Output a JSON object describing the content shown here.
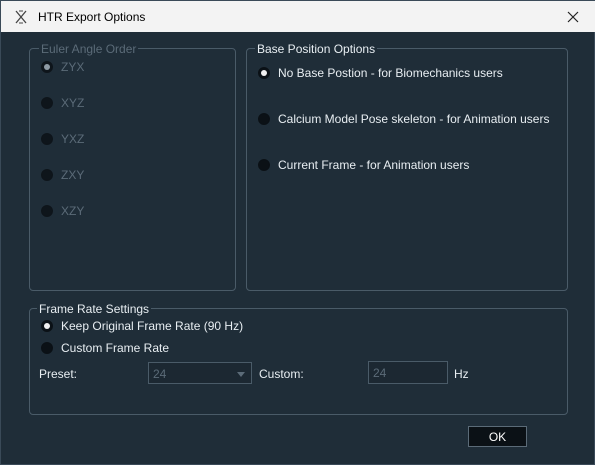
{
  "window": {
    "title": "HTR Export Options",
    "app_icon": "htr-app-icon",
    "close_icon": "close-icon"
  },
  "euler": {
    "legend": "Euler Angle Order",
    "options": [
      "ZYX",
      "XYZ",
      "YXZ",
      "ZXY",
      "XZY"
    ],
    "selected": "ZYX"
  },
  "base": {
    "legend": "Base Position Options",
    "options": [
      "No Base Postion - for Biomechanics users",
      "Calcium Model Pose skeleton - for Animation users",
      "Current Frame - for Animation users"
    ],
    "selected": "No Base Postion - for Biomechanics users"
  },
  "frame_rate": {
    "legend": "Frame Rate Settings",
    "options": [
      "Keep Original Frame Rate (90 Hz)",
      "Custom Frame Rate"
    ],
    "selected": "Keep Original Frame Rate (90 Hz)",
    "preset_label": "Preset:",
    "preset_value": "24",
    "custom_label": "Custom:",
    "custom_value": "24",
    "unit": "Hz"
  },
  "ok_label": "OK"
}
